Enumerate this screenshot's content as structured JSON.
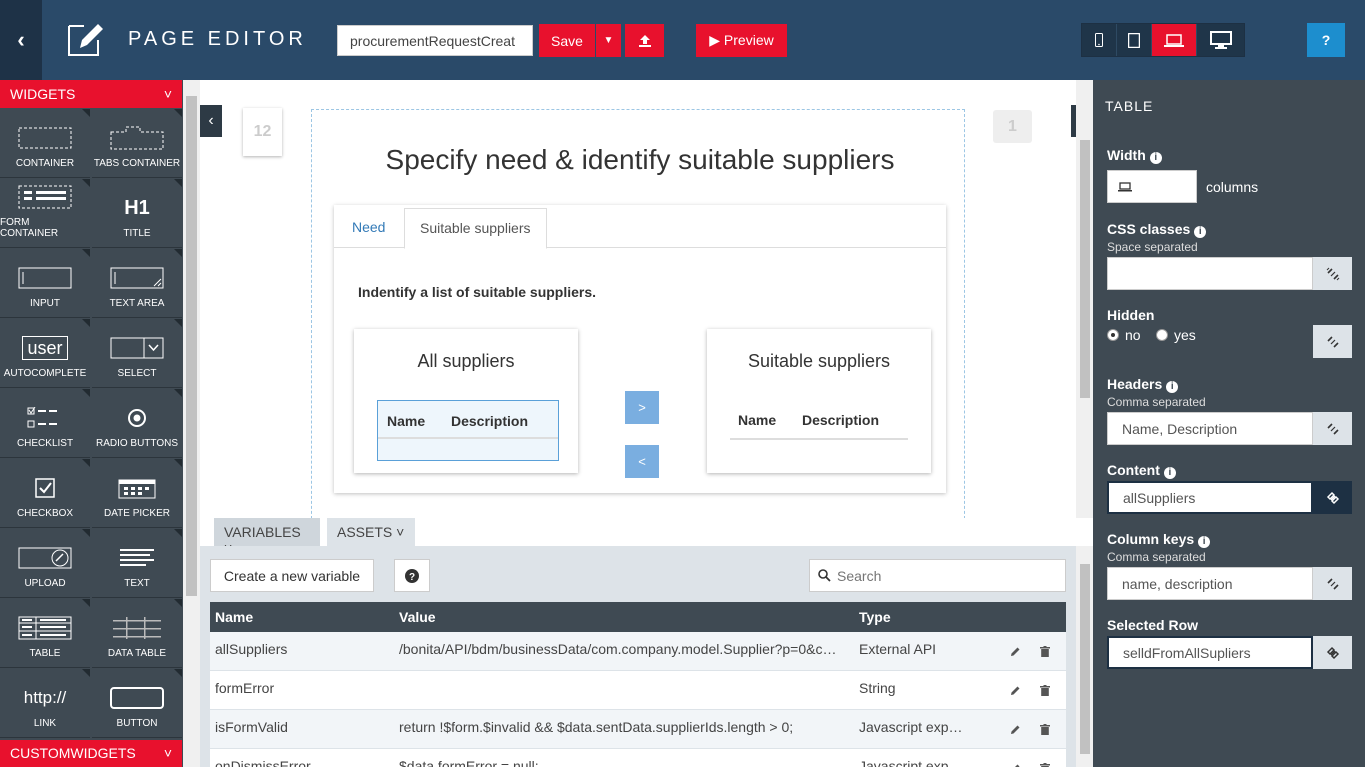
{
  "topbar": {
    "title": "PAGE EDITOR",
    "page_name_value": "procurementRequestCreat",
    "save_label": "Save",
    "preview_label": "▶ Preview",
    "help_label": "?",
    "active_device": "laptop"
  },
  "palette": {
    "header": "WIDGETS",
    "custom_header": "CUSTOMWIDGETS",
    "widgets": [
      {
        "label": "CONTAINER",
        "icon": "container-icon"
      },
      {
        "label": "TABS CONTAINER",
        "icon": "tabs-container-icon"
      },
      {
        "label": "FORM CONTAINER",
        "icon": "form-container-icon"
      },
      {
        "label": "TITLE",
        "icon": "title-icon",
        "glyph": "H1"
      },
      {
        "label": "INPUT",
        "icon": "input-icon"
      },
      {
        "label": "TEXT AREA",
        "icon": "text-area-icon"
      },
      {
        "label": "AUTOCOMPLETE",
        "icon": "autocomplete-icon",
        "glyph": "user"
      },
      {
        "label": "SELECT",
        "icon": "select-icon"
      },
      {
        "label": "CHECKLIST",
        "icon": "checklist-icon"
      },
      {
        "label": "RADIO BUTTONS",
        "icon": "radio-buttons-icon"
      },
      {
        "label": "CHECKBOX",
        "icon": "checkbox-icon"
      },
      {
        "label": "DATE PICKER",
        "icon": "date-picker-icon"
      },
      {
        "label": "UPLOAD",
        "icon": "upload-icon"
      },
      {
        "label": "TEXT",
        "icon": "text-icon"
      },
      {
        "label": "TABLE",
        "icon": "table-icon"
      },
      {
        "label": "DATA TABLE",
        "icon": "data-table-icon"
      },
      {
        "label": "LINK",
        "icon": "link-icon",
        "glyph": "http://"
      },
      {
        "label": "BUTTON",
        "icon": "button-icon"
      }
    ]
  },
  "canvas": {
    "left_badge": "12",
    "right_badge": "1",
    "form_title": "Specify need & identify suitable suppliers",
    "tabs": [
      {
        "label": "Need",
        "active": false
      },
      {
        "label": "Suitable suppliers",
        "active": true
      }
    ],
    "intro": "Indentify a list of suitable suppliers.",
    "panel_all": {
      "title": "All suppliers",
      "col1": "Name",
      "col2": "Description"
    },
    "panel_suitable": {
      "title": "Suitable suppliers",
      "col1": "Name",
      "col2": "Description"
    },
    "move_right": ">",
    "move_left": "<"
  },
  "bottom": {
    "tab_variables": "VARIABLES ˅",
    "tab_assets": "ASSETS ˅",
    "create_label": "Create a new variable",
    "search_placeholder": "Search",
    "headers": {
      "name": "Name",
      "value": "Value",
      "type": "Type"
    },
    "rows": [
      {
        "name": "allSuppliers",
        "value": "/bonita/API/bdm/businessData/com.company.model.Supplier?p=0&c…",
        "type": "External API"
      },
      {
        "name": "formError",
        "value": "",
        "type": "String"
      },
      {
        "name": "isFormValid",
        "value": "return !$form.$invalid && $data.sentData.supplierIds.length > 0;",
        "type": "Javascript exp…"
      },
      {
        "name": "onDismissError",
        "value": "$data.formError = null;",
        "type": "Javascript exp…"
      }
    ]
  },
  "props": {
    "title": "TABLE",
    "width_label": "Width",
    "width_suffix": "columns",
    "css_label": "CSS classes",
    "css_hint": "Space separated",
    "css_value": "",
    "hidden_label": "Hidden",
    "hidden_no": "no",
    "hidden_yes": "yes",
    "headers_label": "Headers",
    "headers_hint": "Comma separated",
    "headers_value": "Name, Description",
    "content_label": "Content",
    "content_value": "allSuppliers",
    "colkeys_label": "Column keys",
    "colkeys_hint": "Comma separated",
    "colkeys_value": "name, description",
    "selected_label": "Selected Row",
    "selected_value": "selldFromAllSupliers"
  },
  "colors": {
    "topbar": "#2a4a69",
    "accent_red": "#e8112d",
    "panel_dark": "#3f4a53",
    "table_blue": "#5aa0d8"
  }
}
